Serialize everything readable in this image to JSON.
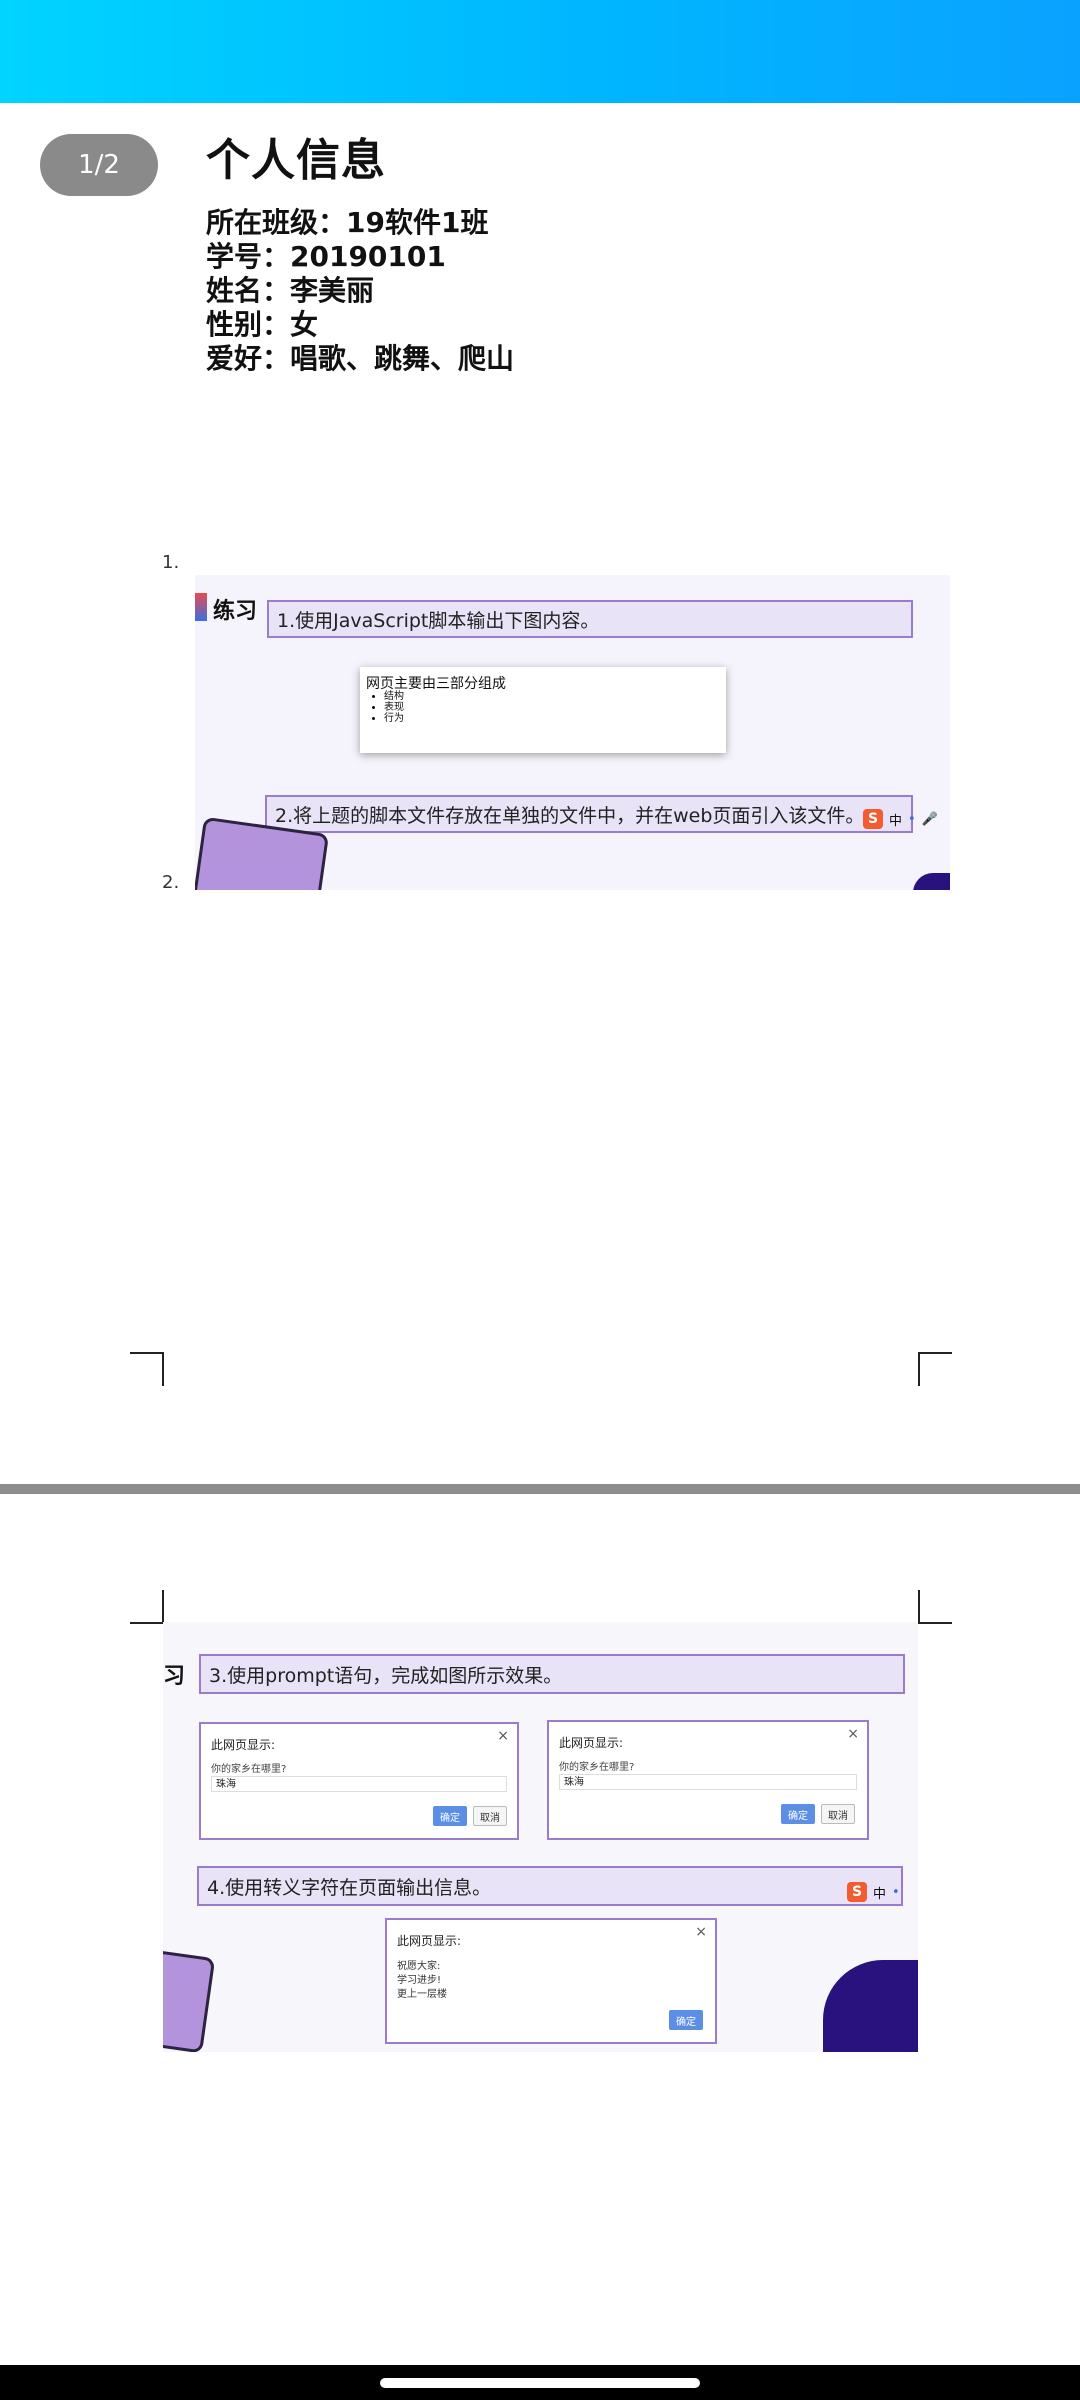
{
  "viewer": {
    "page_indicator": "1/2"
  },
  "page1": {
    "title": "个人信息",
    "info_lines": [
      "所在班级：19软件1班",
      "学号：20190101",
      "姓名：李美丽",
      "性别：女",
      "爱好：唱歌、跳舞、爬山"
    ],
    "list_numbers": [
      "1.",
      "2."
    ],
    "slide1": {
      "badge": "练习",
      "task1": "1.使用JavaScript脚本输出下图内容。",
      "inner_title": "网页主要由三部分组成",
      "inner_items": [
        "结构",
        "表现",
        "行为"
      ],
      "task2": "2.将上题的脚本文件存放在单独的文件中，并在web页面引入该文件。",
      "ime_text": "中"
    }
  },
  "page2": {
    "slide2": {
      "badge": "习",
      "task3": "3.使用prompt语句，完成如图所示效果。",
      "dialog_title": "此网页显示:",
      "dialog_question": "你的家乡在哪里?",
      "dialog_value": "珠海",
      "ok_label": "确定",
      "cancel_label": "取消",
      "task4": "4.使用转义字符在页面输出信息。",
      "msg_lines": [
        "祝愿大家:",
        "学习进步!",
        "更上一层楼"
      ],
      "ime_text": "中"
    }
  }
}
